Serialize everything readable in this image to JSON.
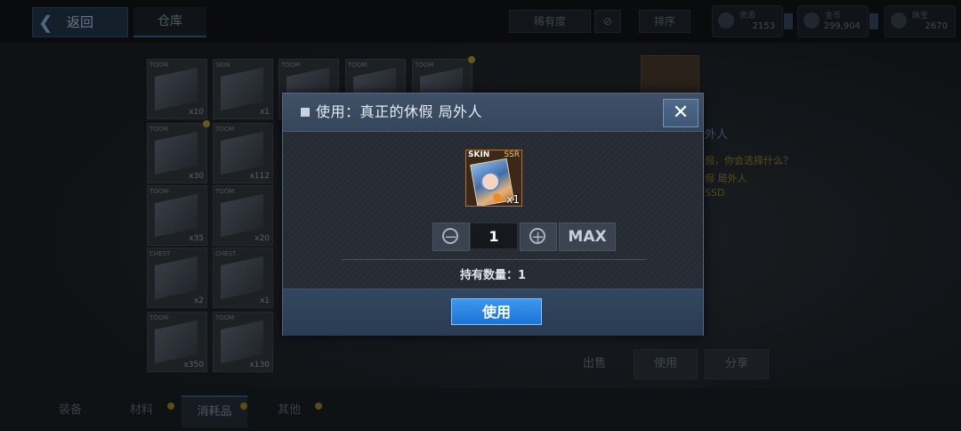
{
  "background": {
    "back_label": "返回",
    "warehouse_tab": "仓库",
    "filter_label": "稀有度",
    "sort_label": "排序",
    "resources": [
      {
        "label": "资源",
        "value": "2153"
      },
      {
        "label": "金币",
        "value": "299,904"
      },
      {
        "label": "珠宝",
        "value": "2670"
      }
    ],
    "inventory": [
      {
        "tag": "TOOM",
        "qty": "x10"
      },
      {
        "tag": "SKIN",
        "qty": "x1"
      },
      {
        "tag": "TOOM",
        "qty": ""
      },
      {
        "tag": "TOOM",
        "qty": ""
      },
      {
        "tag": "TOOM",
        "qty": ""
      },
      {
        "tag": "TOOM",
        "qty": "x30"
      },
      {
        "tag": "TOOM",
        "qty": "x112"
      },
      {
        "tag": "TOOM",
        "qty": "x35"
      },
      {
        "tag": "TOOM",
        "qty": "x20"
      },
      {
        "tag": "CHEST",
        "qty": "x2"
      },
      {
        "tag": "CHEST",
        "qty": "x1"
      },
      {
        "tag": "TOOM",
        "qty": "x350"
      },
      {
        "tag": "TOOM",
        "qty": "x130"
      }
    ],
    "right_texts": [
      "外人",
      "假，你会选择什么？",
      "假 局外人",
      "SSD"
    ],
    "action_buttons": [
      "出售",
      "使用",
      "分享"
    ],
    "bottom_tabs": [
      "装备",
      "材料",
      "消耗品",
      "其他"
    ]
  },
  "dialog": {
    "title": "使用：真正的休假 局外人",
    "close_symbol": "✕",
    "item": {
      "type_tag": "SKIN",
      "rarity": "SSR",
      "count": "x1"
    },
    "stepper": {
      "minus_symbol": "−",
      "value": "1",
      "plus_symbol": "+",
      "max_label": "MAX"
    },
    "owned_label": "持有数量：",
    "owned_value": "1",
    "use_label": "使用"
  }
}
